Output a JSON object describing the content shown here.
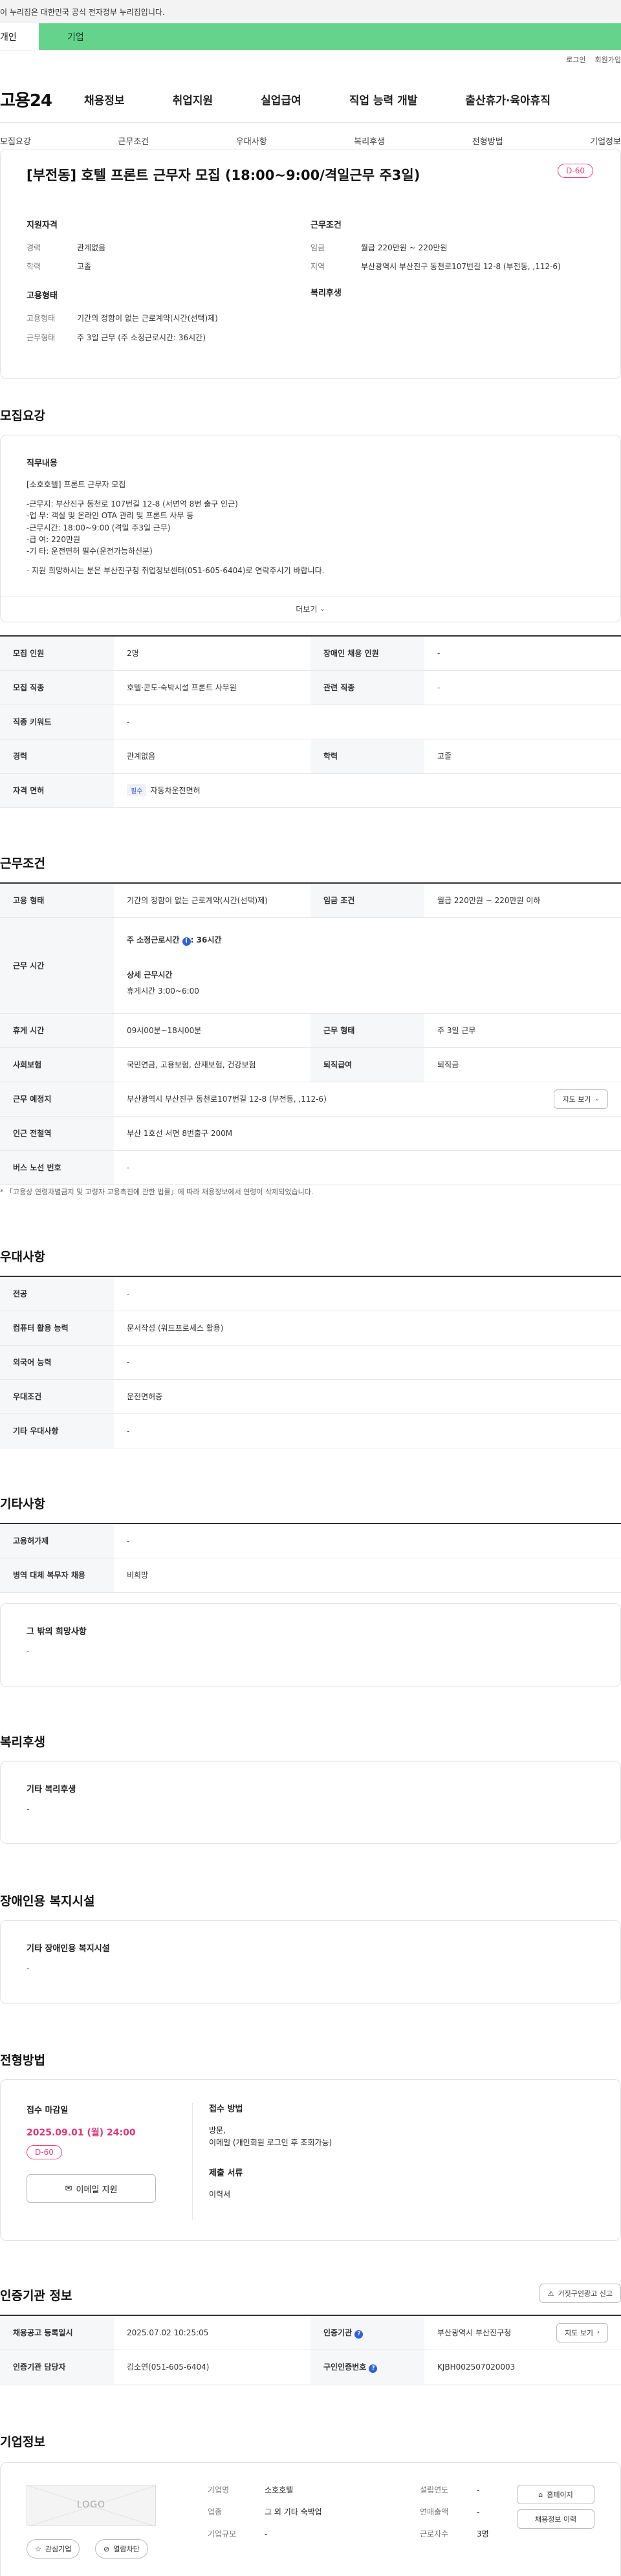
{
  "gov_banner": "이 누리집은 대한민국 공식 전자정부 누리집입니다.",
  "tabs": {
    "person": "개인",
    "corp": "기업"
  },
  "util": {
    "login": "로그인",
    "join": "회원가입"
  },
  "logo": "고용24",
  "gnb": [
    "채용정보",
    "취업지원",
    "실업급여",
    "직업 능력 개발",
    "출산휴가·육아휴직"
  ],
  "anchors": [
    "모집요강",
    "근무조건",
    "우대사항",
    "복리후생",
    "전형방법",
    "기업정보"
  ],
  "summary": {
    "title": "[부전동] 호텔 프론트 근무자 모집 (18:00~9:00/격일근무 주3일)",
    "dday": "D-60",
    "qual_head": "지원자격",
    "career_k": "경력",
    "career_v": "관계없음",
    "edu_k": "학력",
    "edu_v": "고졸",
    "emp_head": "고용형태",
    "emptype_k": "고용형태",
    "emptype_v": "기간의 정함이 없는 근로계약(시간(선택)제)",
    "workform_k": "근무형태",
    "workform_v": "주 3일 근무 (주 소정근로시간: 36시간)",
    "cond_head": "근무조건",
    "wage_k": "임금",
    "wage_v": "월급 220만원 ~ 220만원",
    "region_k": "지역",
    "region_v": "부산광역시 부산진구 동천로107번길 12-8 (부전동, ,112-6)",
    "welfare_head": "복리후생"
  },
  "recruit": {
    "title": "모집요강",
    "duty_head": "직무내용",
    "duty_lines": [
      "[소호호텔] 프론트 근무자 모집",
      "",
      "-근무지: 부산진구 동천로 107번길 12-8 (서면역 8번 출구 인근)",
      "-업   무: 객실 및 온라인 OTA 관리 및 프론트 사무 등",
      "-근무시간: 18:00~9:00 (격일 주3일 근무)",
      "-급   여: 220만원",
      "-기   타: 운전면허 필수(운전가능하신분)",
      "",
      "- 지원 희망하시는 분은 부산진구청 취업정보센터(051-605-6404)로 연락주시기 바랍니다."
    ],
    "more": "더보기",
    "rows": [
      {
        "k1": "모집 인원",
        "v1": "2명",
        "k2": "장애인 채용 인원",
        "v2": "-"
      },
      {
        "k1": "모집 직종",
        "v1": "호텔·콘도·숙박시설 프론트 사무원",
        "k2": "관련 직종",
        "v2": "-"
      }
    ],
    "keyword_k": "직종 키워드",
    "keyword_v": "-",
    "career_k": "경력",
    "career_v": "관계없음",
    "edu_k": "학력",
    "edu_v": "고졸",
    "license_k": "자격 면허",
    "license_chip": "필수",
    "license_v": "자동차운전면허"
  },
  "conditions": {
    "title": "근무조건",
    "emptype_k": "고용 형태",
    "emptype_v": "기간의 정함이 없는 근로계약(시간(선택)제)",
    "wage_k": "임금 조건",
    "wage_v": "월급 220만원 ~ 220만원 이하",
    "hours_k": "근무 시간",
    "hours_weekly": "주 소정근로시간",
    "hours_weekly_v": ": 36시간",
    "hours_detail_head": "상세 근무시간",
    "hours_detail_v": "휴게시간 3:00~6:00",
    "break_k": "휴게 시간",
    "break_v": "09시00분~18시00분",
    "workform_k": "근무 형태",
    "workform_v": "주 3일 근무",
    "insurance_k": "사회보험",
    "insurance_v": "국민연금, 고용보험, 산재보험, 건강보험",
    "retire_k": "퇴직급여",
    "retire_v": "퇴직금",
    "place_k": "근무 예정지",
    "place_v": "부산광역시 부산진구 동천로107번길 12-8 (부전동, ,112-6)",
    "map_btn": "지도 보기",
    "subway_k": "인근 전철역",
    "subway_v": "부산 1호선 서면 8번출구 200M",
    "bus_k": "버스 노선 번호",
    "bus_v": "-",
    "note": "* 「고용상 연령차별금지 및 고령자 고용촉진에 관한 법률」에 따라 채용정보에서 연령이 삭제되었습니다."
  },
  "preference": {
    "title": "우대사항",
    "rows": [
      {
        "k": "전공",
        "v": "-"
      },
      {
        "k": "컴퓨터 활용 능력",
        "v": "문서작성 (워드프로세스 활용)"
      },
      {
        "k": "외국어 능력",
        "v": "-"
      },
      {
        "k": "우대조건",
        "v": "운전면허증"
      },
      {
        "k": "기타 우대사항",
        "v": "-"
      }
    ]
  },
  "other": {
    "title": "기타사항",
    "rows": [
      {
        "k": "고용허가제",
        "v": "-"
      },
      {
        "k": "병역 대체 복무자 채용",
        "v": "비희망"
      }
    ],
    "wish_head": "그 밖의 희망사항",
    "wish_v": "-"
  },
  "welfare": {
    "title": "복리후생",
    "head": "기타 복리후생",
    "v": "-"
  },
  "disabled": {
    "title": "장애인용 복지시설",
    "head": "기타 장애인용 복지시설",
    "v": "-"
  },
  "selection": {
    "title": "전형방법",
    "deadline_head": "접수 마감일",
    "deadline_v": "2025.09.01 (월) 24:00",
    "dday": "D-60",
    "email_btn": "이메일 지원",
    "method_head": "접수 방법",
    "method_v1": "방문,",
    "method_v2": "이메일 (개인회원 로그인 후 조회가능)",
    "docs_head": "제출 서류",
    "docs_v": "이력서"
  },
  "cert": {
    "title": "인증기관 정보",
    "report_btn": "거짓구인광고 신고",
    "reg_k": "채용공고 등록일시",
    "reg_v": "2025.07.02 10:25:05",
    "org_k": "인증기관",
    "org_v": "부산광역시 부산진구청",
    "map_btn": "지도 보기",
    "mgr_k": "인증기관 담당자",
    "mgr_v": "김소연(051-605-6404)",
    "num_k": "구인인증번호",
    "num_v": "KJBH002507020003"
  },
  "company": {
    "title": "기업정보",
    "logo_text": "LOGO",
    "fav_btn": "관심기업",
    "block_btn": "열람차단",
    "name_k": "기업명",
    "name_v": "소호호텔",
    "industry_k": "업종",
    "industry_v": "그 외 기타 숙박업",
    "scale_k": "기업규모",
    "scale_v": "-",
    "year_k": "설립연도",
    "year_v": "-",
    "sales_k": "연매출액",
    "sales_v": "-",
    "staff_k": "근로자수",
    "staff_v": "3명",
    "home_btn": "홈페이지",
    "history_btn": "채용정보 이력"
  }
}
